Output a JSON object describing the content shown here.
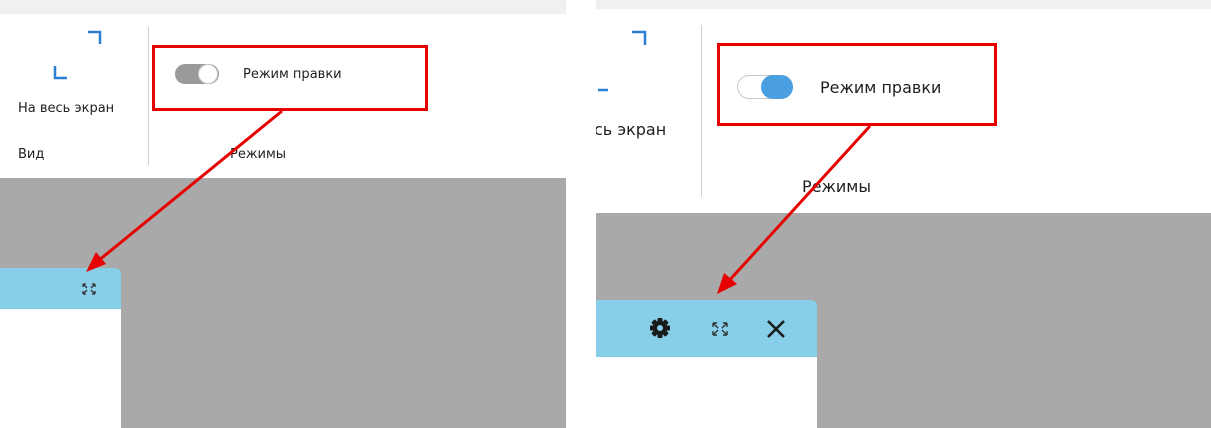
{
  "colors": {
    "window_header": "#87cee9",
    "workspace": "#a9a9a9",
    "highlight": "#e60000",
    "toggle_off": "#9a9a9a",
    "toggle_on": "#4a9fe0"
  },
  "before": {
    "fullscreen_label": "На весь экран",
    "group_view": "Вид",
    "toggle_label": "Режим правки",
    "toggle_state": "off",
    "group_modes": "Режимы"
  },
  "after": {
    "fullscreen_label": "сь экран",
    "toggle_label": "Режим правки",
    "toggle_state": "on",
    "group_modes": "Режимы",
    "window_icons": [
      "gear-icon",
      "expand-icon",
      "close-icon"
    ]
  }
}
